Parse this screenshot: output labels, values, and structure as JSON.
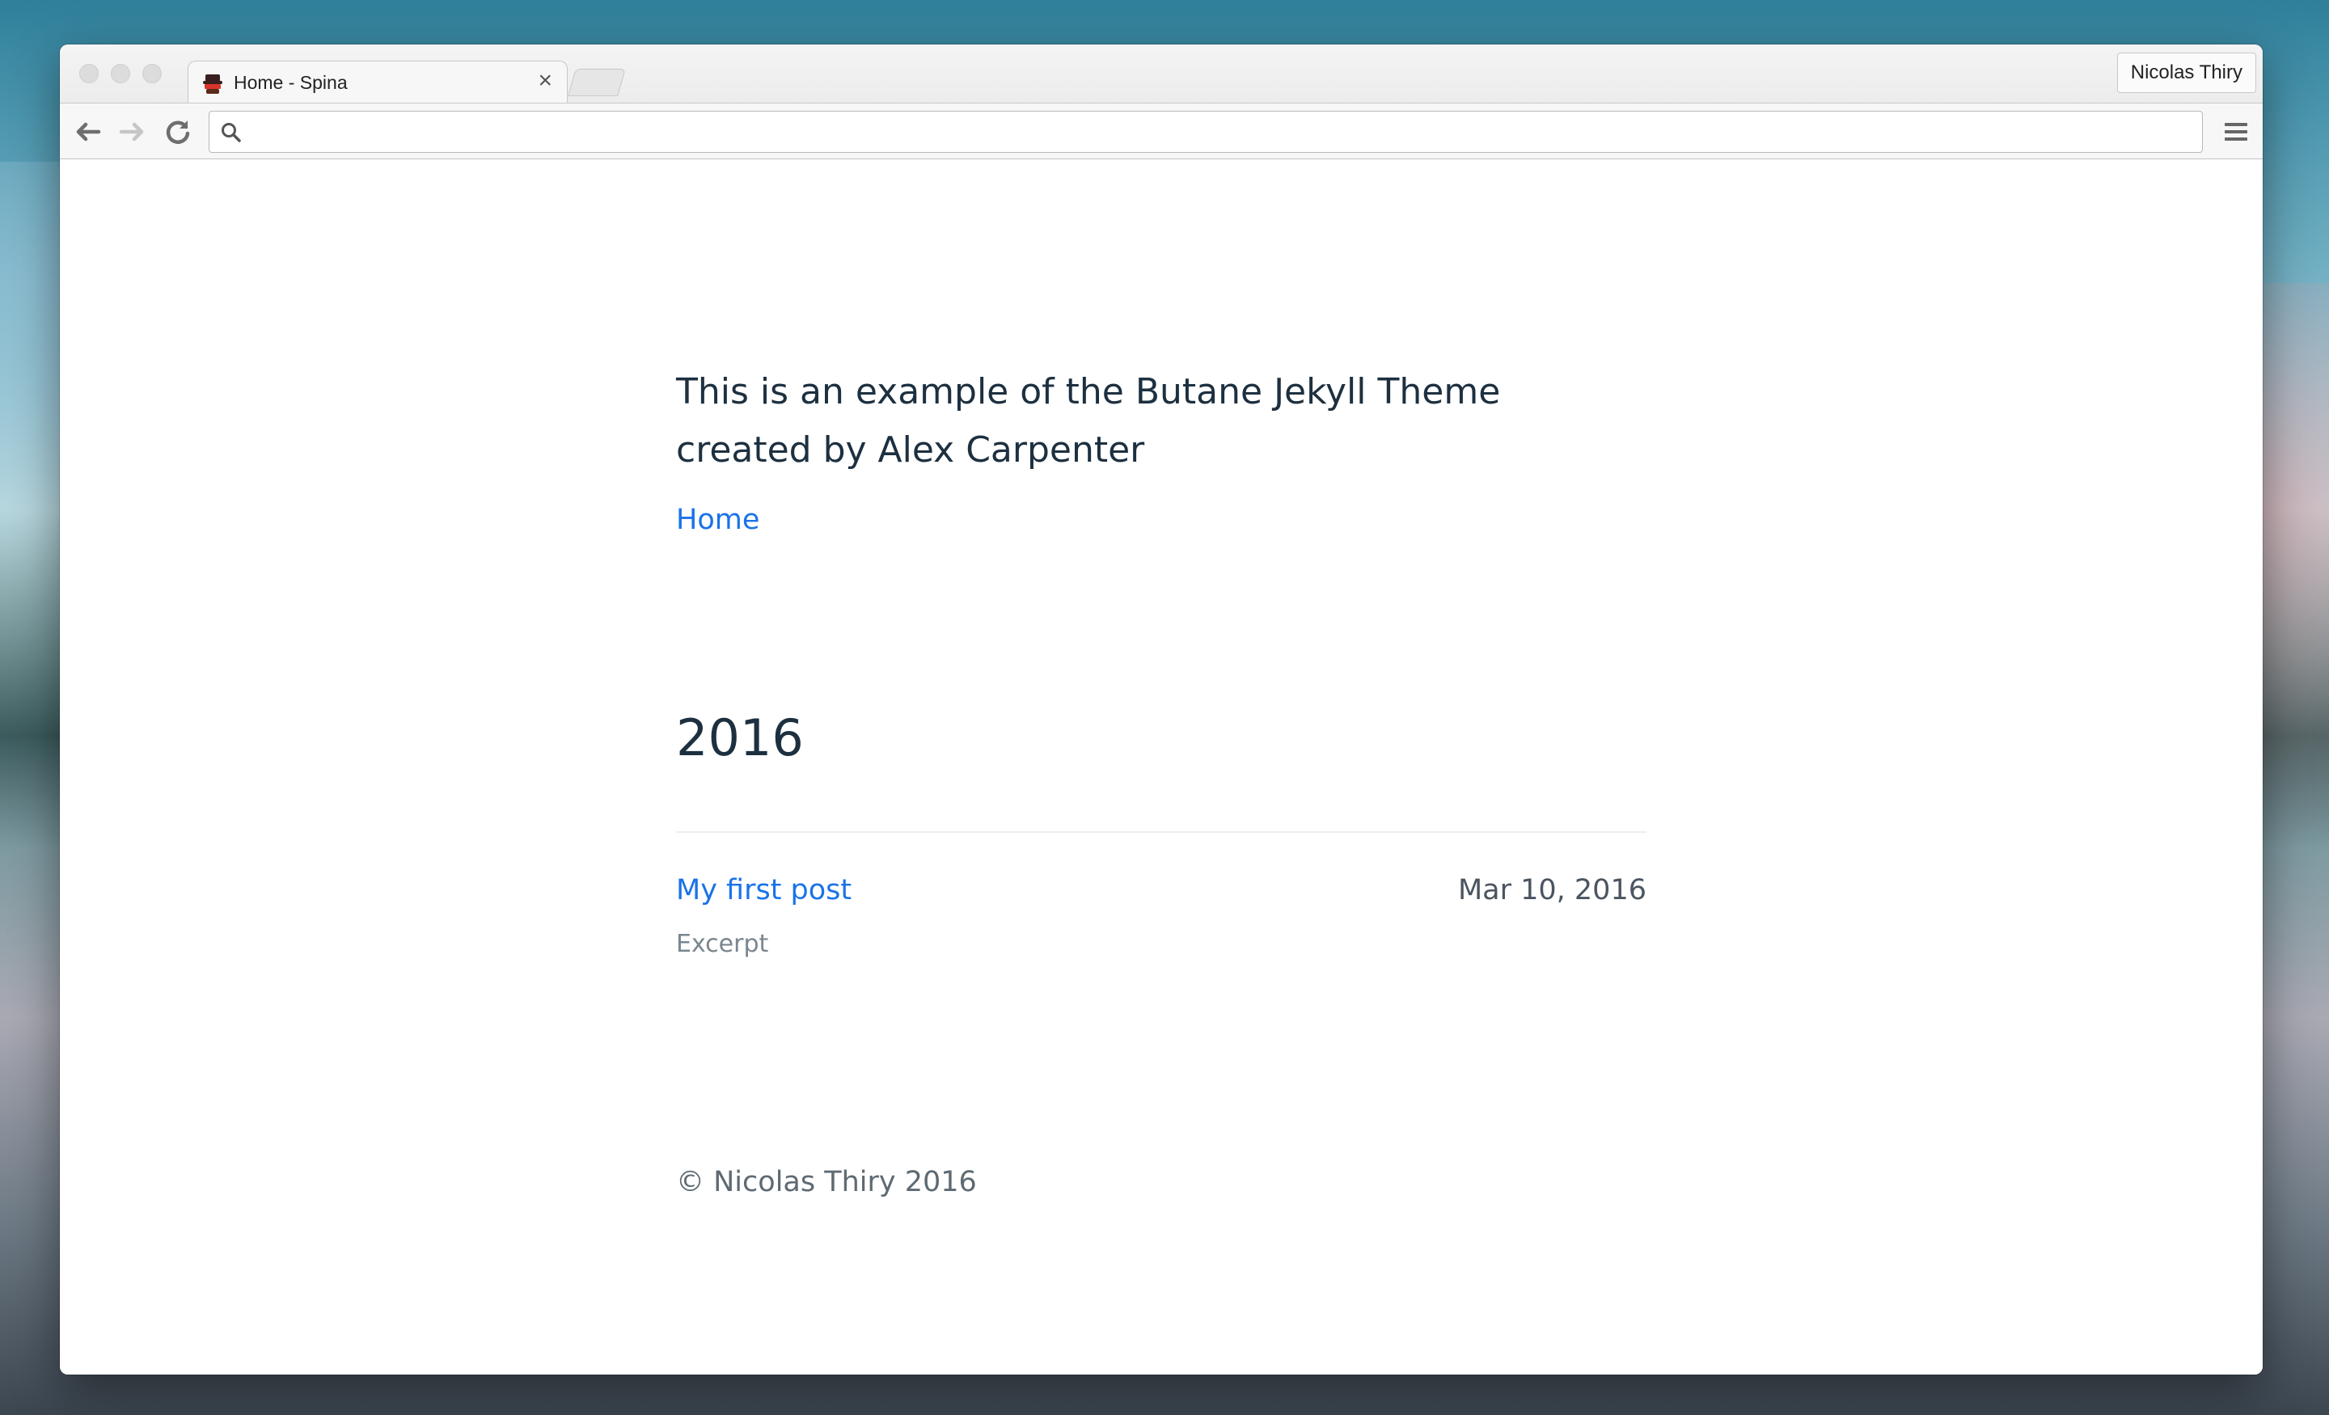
{
  "browser": {
    "tab": {
      "title": "Home - Spina",
      "close_glyph": "×",
      "favicon": "spina-logo-icon"
    },
    "profile_name": "Nicolas Thiry",
    "omnibox": {
      "value": "",
      "placeholder": ""
    },
    "icons": {
      "back": "arrow-left-icon",
      "forward": "arrow-right-icon",
      "reload": "reload-icon",
      "search": "search-icon",
      "menu": "hamburger-menu-icon"
    }
  },
  "page": {
    "intro": "This is an example of the Butane Jekyll Theme created by Alex Carpenter",
    "nav": {
      "home": "Home"
    },
    "archive": {
      "year": "2016",
      "posts": [
        {
          "title": "My first post",
          "date": "Mar 10, 2016",
          "excerpt": "Excerpt"
        }
      ]
    },
    "footer": "© Nicolas Thiry 2016"
  },
  "colors": {
    "link": "#1a73e8",
    "text": "#1d3040",
    "muted": "#7a868e",
    "window_chrome": "#f4f4f4"
  }
}
